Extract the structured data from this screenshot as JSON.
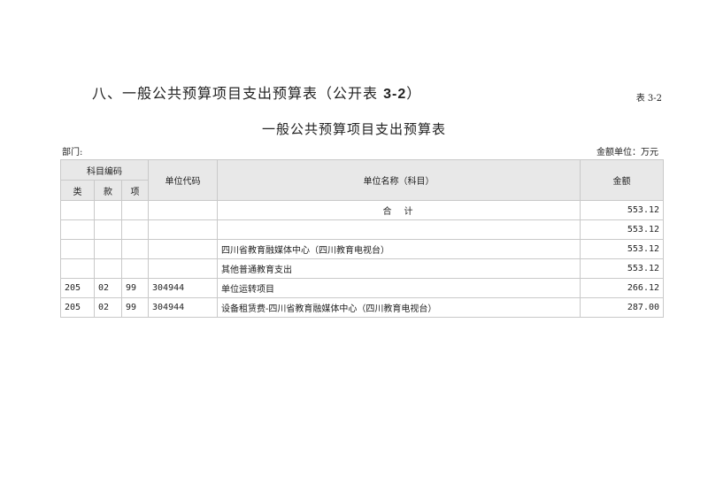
{
  "heading": {
    "prefix": "八、一般公共预算项目支出预算表（公开表 ",
    "code": "3-2",
    "suffix": "）"
  },
  "table_no": "表 3-2",
  "title": "一般公共预算项目支出预算表",
  "department_label": "部门:",
  "unit_label": "金额单位：万元",
  "headers": {
    "subject_code": "科目编码",
    "class": "类",
    "section": "款",
    "item": "项",
    "unit_code": "单位代码",
    "unit_name": "单位名称（科目）",
    "amount": "金额"
  },
  "rows": [
    {
      "class": "",
      "section": "",
      "item": "",
      "unit_code": "",
      "name": "合　计",
      "amount": "553.12"
    },
    {
      "class": "",
      "section": "",
      "item": "",
      "unit_code": "",
      "name": "",
      "amount": "553.12"
    },
    {
      "class": "",
      "section": "",
      "item": "",
      "unit_code": "",
      "name": "四川省教育融媒体中心（四川教育电视台）",
      "amount": "553.12"
    },
    {
      "class": "",
      "section": "",
      "item": "",
      "unit_code": "",
      "name": "其他普通教育支出",
      "amount": "553.12"
    },
    {
      "class": "205",
      "section": "02",
      "item": "99",
      "unit_code": "304944",
      "name": "单位运转项目",
      "amount": "266.12"
    },
    {
      "class": "205",
      "section": "02",
      "item": "99",
      "unit_code": "304944",
      "name": "设备租赁费-四川省教育融媒体中心（四川教育电视台）",
      "amount": "287.00"
    }
  ]
}
